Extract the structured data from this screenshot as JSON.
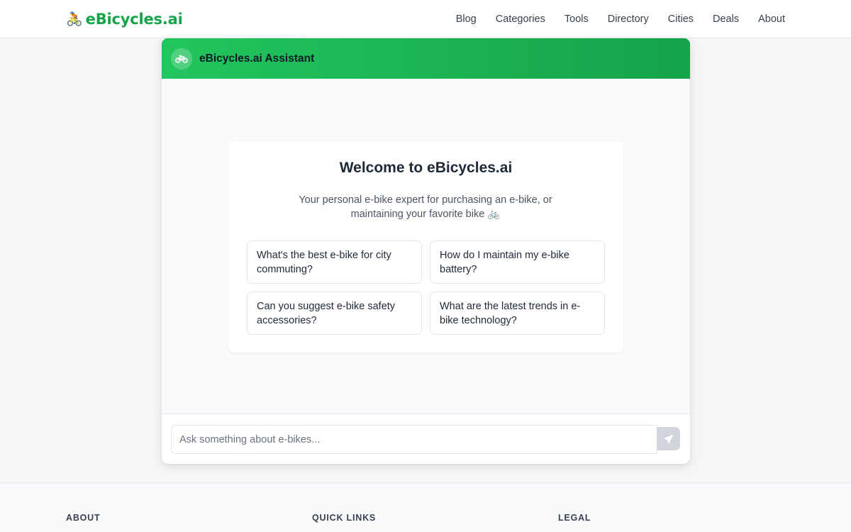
{
  "brand": {
    "emoji": "🚴",
    "name": "eBicycles.ai",
    "color": "#16a34a"
  },
  "nav": {
    "items": [
      {
        "label": "Blog"
      },
      {
        "label": "Categories"
      },
      {
        "label": "Tools"
      },
      {
        "label": "Directory"
      },
      {
        "label": "Cities"
      },
      {
        "label": "Deals"
      },
      {
        "label": "About"
      }
    ]
  },
  "chat": {
    "header_icon": "bicycle-icon",
    "title": "eBicycles.ai Assistant",
    "header_gradient": [
      "#22c55e",
      "#16a34a"
    ],
    "welcome": {
      "title": "Welcome to eBicycles.ai",
      "subtitle_line1": "Your personal e-bike expert for purchasing an e-bike, or",
      "subtitle_line2": "maintaining your favorite bike 🚲",
      "suggestions": [
        {
          "text": "What's the best e-bike for city commuting?"
        },
        {
          "text": "How do I maintain my e-bike battery?"
        },
        {
          "text": "Can you suggest e-bike safety accessories?"
        },
        {
          "text": "What are the latest trends in e-bike technology?"
        }
      ]
    },
    "input": {
      "value": "",
      "placeholder": "Ask something about e-bikes..."
    },
    "send_icon": "paper-plane-icon"
  },
  "footer": {
    "headings": [
      "ABOUT",
      "QUICK LINKS",
      "LEGAL"
    ]
  }
}
